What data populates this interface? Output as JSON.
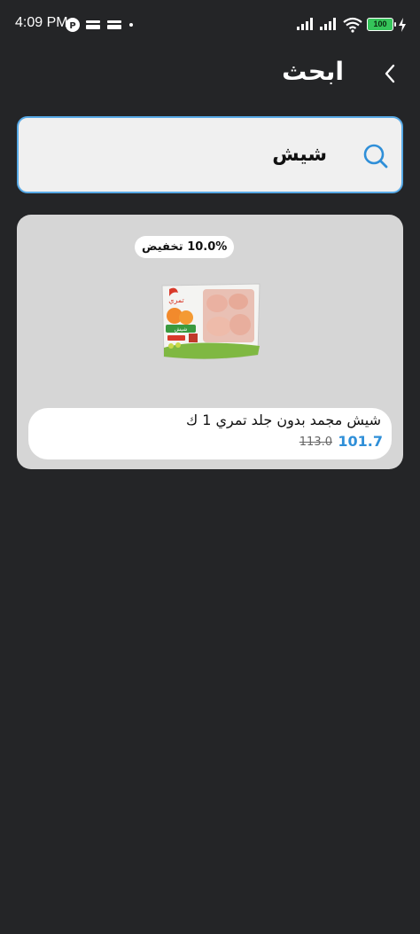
{
  "status_bar": {
    "time": "4:09 PM",
    "battery": "100"
  },
  "header": {
    "title": "ابحث"
  },
  "search": {
    "value": "شيش"
  },
  "products": [
    {
      "discount_badge": "10.0% تخفيض",
      "name": "شيش مجمد بدون جلد تمري 1 ك",
      "price": "101.7",
      "old_price": "113.0"
    }
  ],
  "colors": {
    "background": "#242527",
    "accent": "#2f8fd8",
    "search_border": "#57a9e6",
    "card_bg": "#d6d6d6"
  }
}
